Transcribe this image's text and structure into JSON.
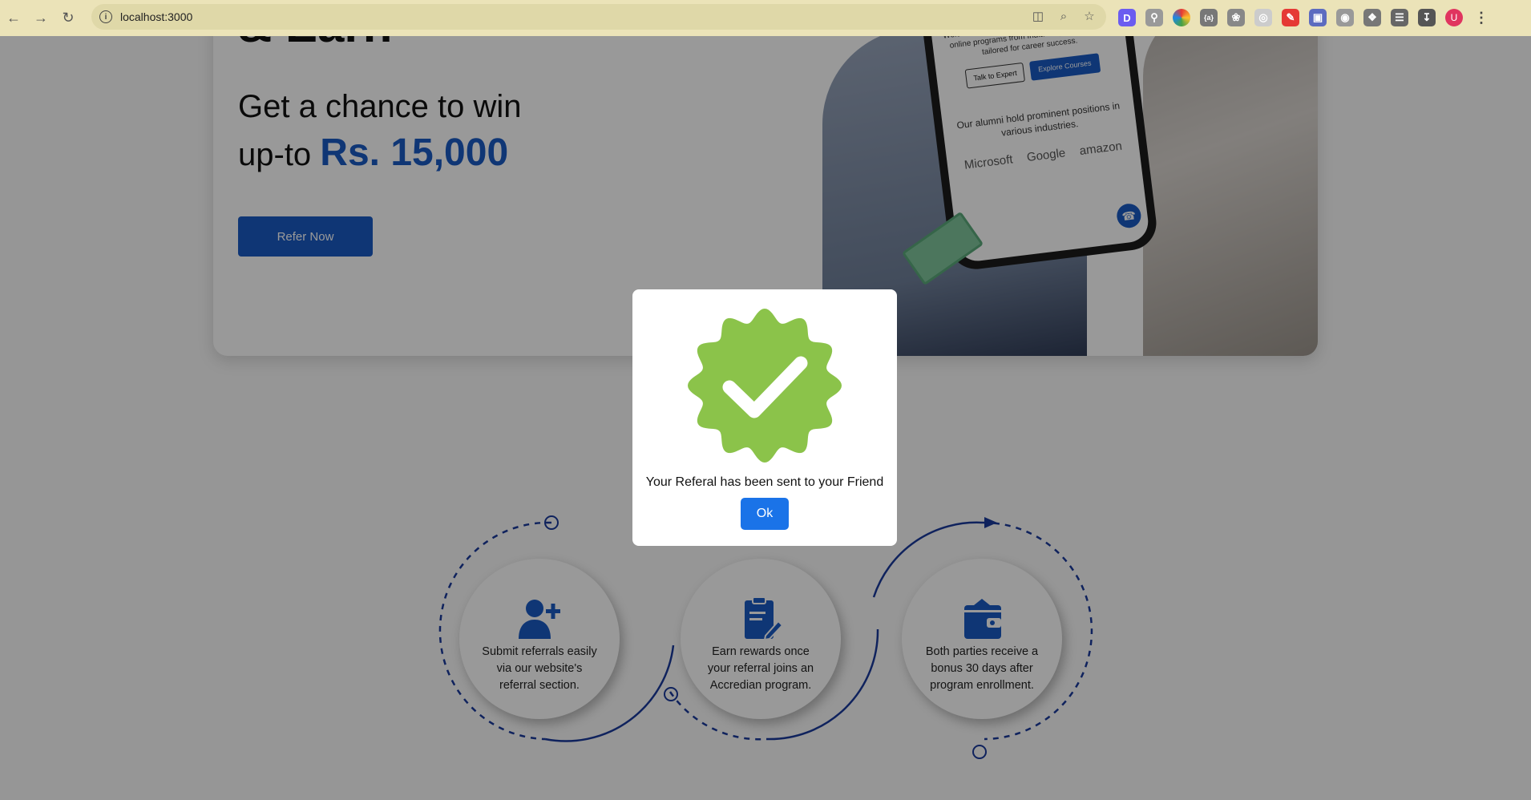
{
  "browser": {
    "url": "localhost:3000",
    "avatar_letter": "U"
  },
  "hero": {
    "top_text": "& Earn",
    "heading_line1": "Get a chance to win",
    "heading_prefix": "up-to ",
    "heading_amount": "Rs. 15,000",
    "refer_button": "Refer Now",
    "phone": {
      "welcome": "Welcome to Accredian, your gateway to premier online programs from India's top universities, tailored for career success.",
      "talk_button": "Talk to Expert",
      "explore_button": "Explore Courses",
      "alumni_text": "Our alumni hold prominent positions in various industries.",
      "logos": [
        "Microsoft",
        "Google",
        "amazon"
      ]
    }
  },
  "steps": [
    {
      "text": "Submit referrals easily via our website's referral section."
    },
    {
      "text": "Earn rewards once your referral joins an Accredian program."
    },
    {
      "text": "Both parties receive a bonus 30 days after program enrollment."
    }
  ],
  "modal": {
    "message": "Your Referal has been sent to your Friend",
    "ok_button": "Ok"
  },
  "colors": {
    "primary": "#1a5bc4",
    "success_badge": "#8bc34a",
    "ok_button": "#1a73e8",
    "chrome": "#ebe3b8"
  }
}
